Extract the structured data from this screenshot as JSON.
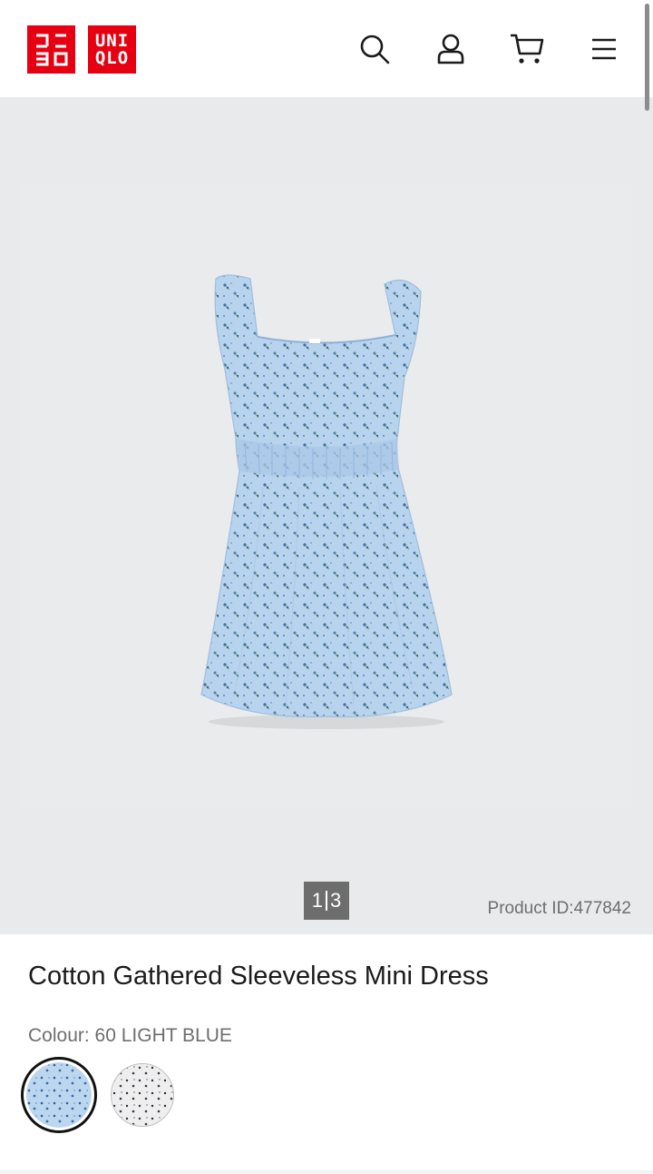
{
  "brand": {
    "logo_kana": "ユニクロ",
    "logo_latin_line1": "UNI",
    "logo_latin_line2": "QLO",
    "red": "#e60012"
  },
  "header_icons": [
    "search-icon",
    "account-icon",
    "cart-icon",
    "menu-icon"
  ],
  "gallery": {
    "current_page": "1",
    "total_pages": "3",
    "product_id_text": "Product ID:477842"
  },
  "product": {
    "name": "Cotton Gathered Sleeveless Mini Dress",
    "colour_label": "Colour: 60 LIGHT BLUE",
    "swatches": [
      {
        "name": "60 LIGHT BLUE",
        "selected": true,
        "color": "#bcd6ef"
      },
      {
        "name": "Off white",
        "selected": false,
        "color": "#eeeeee"
      }
    ]
  }
}
